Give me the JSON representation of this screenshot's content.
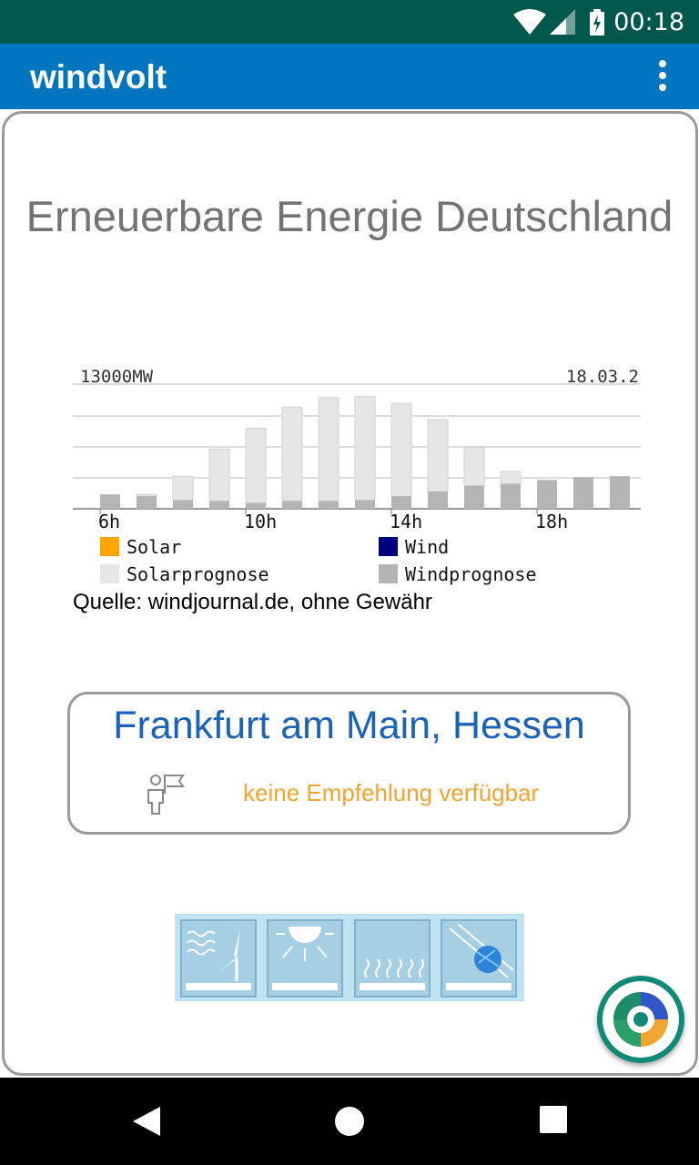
{
  "status_bar": {
    "time": "00:18"
  },
  "app_bar": {
    "title": "windvolt"
  },
  "main": {
    "heading": "Erneuerbare Energie Deutschland",
    "source_note": "Quelle: windjournal.de, ohne Gewähr"
  },
  "chart_data": {
    "type": "bar",
    "header_left": "13000MW",
    "header_right": "18.03.2",
    "x_ticks": [
      "6h",
      "10h",
      "14h",
      "18h"
    ],
    "ylim": [
      0,
      13000
    ],
    "grid": true,
    "legend": [
      "Solar",
      "Wind",
      "Solarprognose",
      "Windprognose"
    ],
    "series": [
      {
        "name": "Solarprognose",
        "values": [
          0,
          200,
          2500,
          5400,
          7800,
          9800,
          10800,
          10800,
          9700,
          7500,
          4000,
          1300,
          0,
          0,
          0
        ]
      },
      {
        "name": "Windprognose",
        "values": [
          1500,
          1300,
          900,
          800,
          600,
          800,
          800,
          900,
          1300,
          1800,
          2400,
          2600,
          3000,
          3300,
          3400
        ]
      }
    ],
    "colors": {
      "Solar": "#ffa500",
      "Wind": "#00007f",
      "Solarprognose": "#e6e6e6",
      "Windprognose": "#b4b4b4"
    }
  },
  "location": {
    "title": "Frankfurt am Main, Hessen",
    "recommendation": "keine Empfehlung verfügbar"
  },
  "icons": {
    "signal": "wifi-icon",
    "cell": "cell-signal-icon",
    "battery": "battery-charging-icon",
    "menu": "more-vert-icon",
    "recommend": "person-flag-icon",
    "fab": "target-icon"
  }
}
